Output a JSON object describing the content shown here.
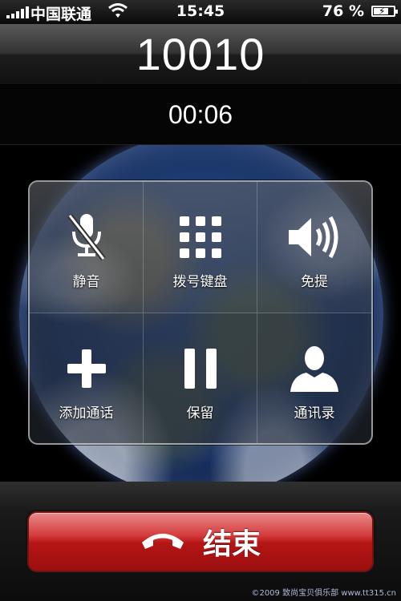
{
  "status_bar": {
    "carrier": "中国联通",
    "time": "15:45",
    "battery_percent": "76 %",
    "battery_level": 0.76,
    "signal_bars": 5
  },
  "call": {
    "number": "10010",
    "duration": "00:06"
  },
  "controls": [
    {
      "label": "静音",
      "icon": "mute-icon"
    },
    {
      "label": "拨号键盘",
      "icon": "keypad-icon"
    },
    {
      "label": "免提",
      "icon": "speaker-icon"
    },
    {
      "label": "添加通话",
      "icon": "plus-icon"
    },
    {
      "label": "保留",
      "icon": "pause-icon"
    },
    {
      "label": "通讯录",
      "icon": "contact-icon"
    }
  ],
  "end_call": {
    "label": "结束",
    "color": "#c41e1e"
  },
  "watermark": "©2009 致尚宝贝俱乐部 www.tt315.cn"
}
